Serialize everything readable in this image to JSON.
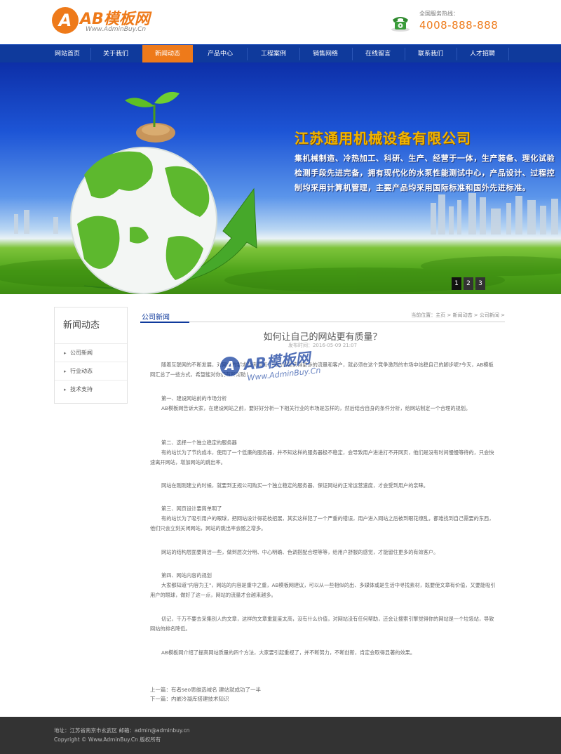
{
  "header": {
    "logo_mark": "A",
    "logo_text": "AB模板网",
    "logo_sub": "Www.AdminBuy.Cn",
    "hotline_label": "全国服务热线：",
    "hotline_number": "4008-888-888"
  },
  "nav": {
    "items": [
      {
        "label": "网站首页"
      },
      {
        "label": "关于我们"
      },
      {
        "label": "新闻动态",
        "active": true
      },
      {
        "label": "产品中心"
      },
      {
        "label": "工程案例"
      },
      {
        "label": "销售网络"
      },
      {
        "label": "在线留言"
      },
      {
        "label": "联系我们"
      },
      {
        "label": "人才招聘"
      }
    ]
  },
  "banner": {
    "title": "江苏通用机械设备有限公司",
    "desc": "集机械制造、冷热加工、科研、生产、经营于一体，生产装备、理化试验检测手段先进完备，拥有现代化的水泵性能测试中心，产品设计、过程控制均采用计算机管理，主要产品均采用国际标准和国外先进标准。",
    "pager": [
      "1",
      "2",
      "3"
    ]
  },
  "sidebar": {
    "title": "新闻动态",
    "items": [
      {
        "label": "公司新闻"
      },
      {
        "label": "行业动态"
      },
      {
        "label": "技术支持"
      }
    ]
  },
  "main": {
    "section_title": "公司新闻",
    "breadcrumb": "当前位置：主页 > 新闻动态 > 公司新闻 >",
    "article_title": "如何让自己的网站更有质量？",
    "article_meta": "发布时间：2016-05-09 21:07",
    "paragraphs": [
      "随着互联网的不断发展，对网站的要求越来越高，网站想要获得更多的流量和客户，就必须在这个竞争激烈的市场中站稳自己的脚步呢?今天，AB模板网汇总了一些方式，希望能对你们有所帮助！",
      "第一、建设网站前的市场分析",
      "AB模板网告诉大家，在建设网站之前，要好好分析一下相关行业的市场是怎样的，然后结合自身的条件分析，给网站制定一个合理的规划。",
      "第二、选择一个独立稳定的服务器",
      "有的站长为了节约成本，使用了一个低廉的服务器，并不知这样的服务器极不稳定，会导致用户进进打不开网页，他们是没有时间慢慢等待的，只会快速离开网站，增加网站的跳出率。",
      "网站在刚刚建立的时候，就要到正规公司购买一个独立稳定的服务器，保证网站的正常运营速度，才会受到用户的亲睐。",
      "第三、网页设计要简单明了",
      "有的站长为了吸引用户的眼球，把网站设计得花枝招展，其实这样犯了一个严重的错误，用户进入网站之后被到眼花缭乱，都难找到自己需要的东西，他们只会立刻关闭网站，网站的跳出率会随之增多。",
      "网站的结构层面要简洁一些，做到层次分明、中心明确、色调搭配合理等等，给用户舒服的感觉，才能留住更多的有效客户。",
      "第四、网站内容的规划",
      "大家都知道\"内容为王\"，网站的内容是重中之重，AB模板网建议，可以从一些相似的出、多媒体或是生活中寻找素材，既要使文章有价值，又要能吸引用户的眼球，做好了这一点，网站的流量才会越来越多。",
      "切记，千万不要去采集别人的文章，这样的文章重复度太高，没有什么价值，对网站没有任何帮助，还会让搜索引擎觉得你的网站是一个垃圾站，导致网站的排名降低。",
      "AB模板网介绍了提高网站质量的四个方法，大家要引起重视了，并不断努力，不断创新，肯定会取得显著的效果。"
    ],
    "prev": "上一篇：有者seo思维选域名 建站就成功了一半",
    "next": "下一篇：内嵌冷凝库搭建技术知识"
  },
  "watermark": {
    "mark": "A",
    "text": "AB模板网",
    "sub": "Www.AdminBuy.Cn"
  },
  "footer": {
    "address": "地址：江苏省南京市玄武区 邮箱：admin@adminbuy.cn",
    "copyright": "Copyright © Www.AdminBuy.Cn 版权所有"
  },
  "colors": {
    "brand_orange": "#ee7a1a",
    "nav_blue": "#0f3a9c",
    "footer_dark": "#333333"
  }
}
